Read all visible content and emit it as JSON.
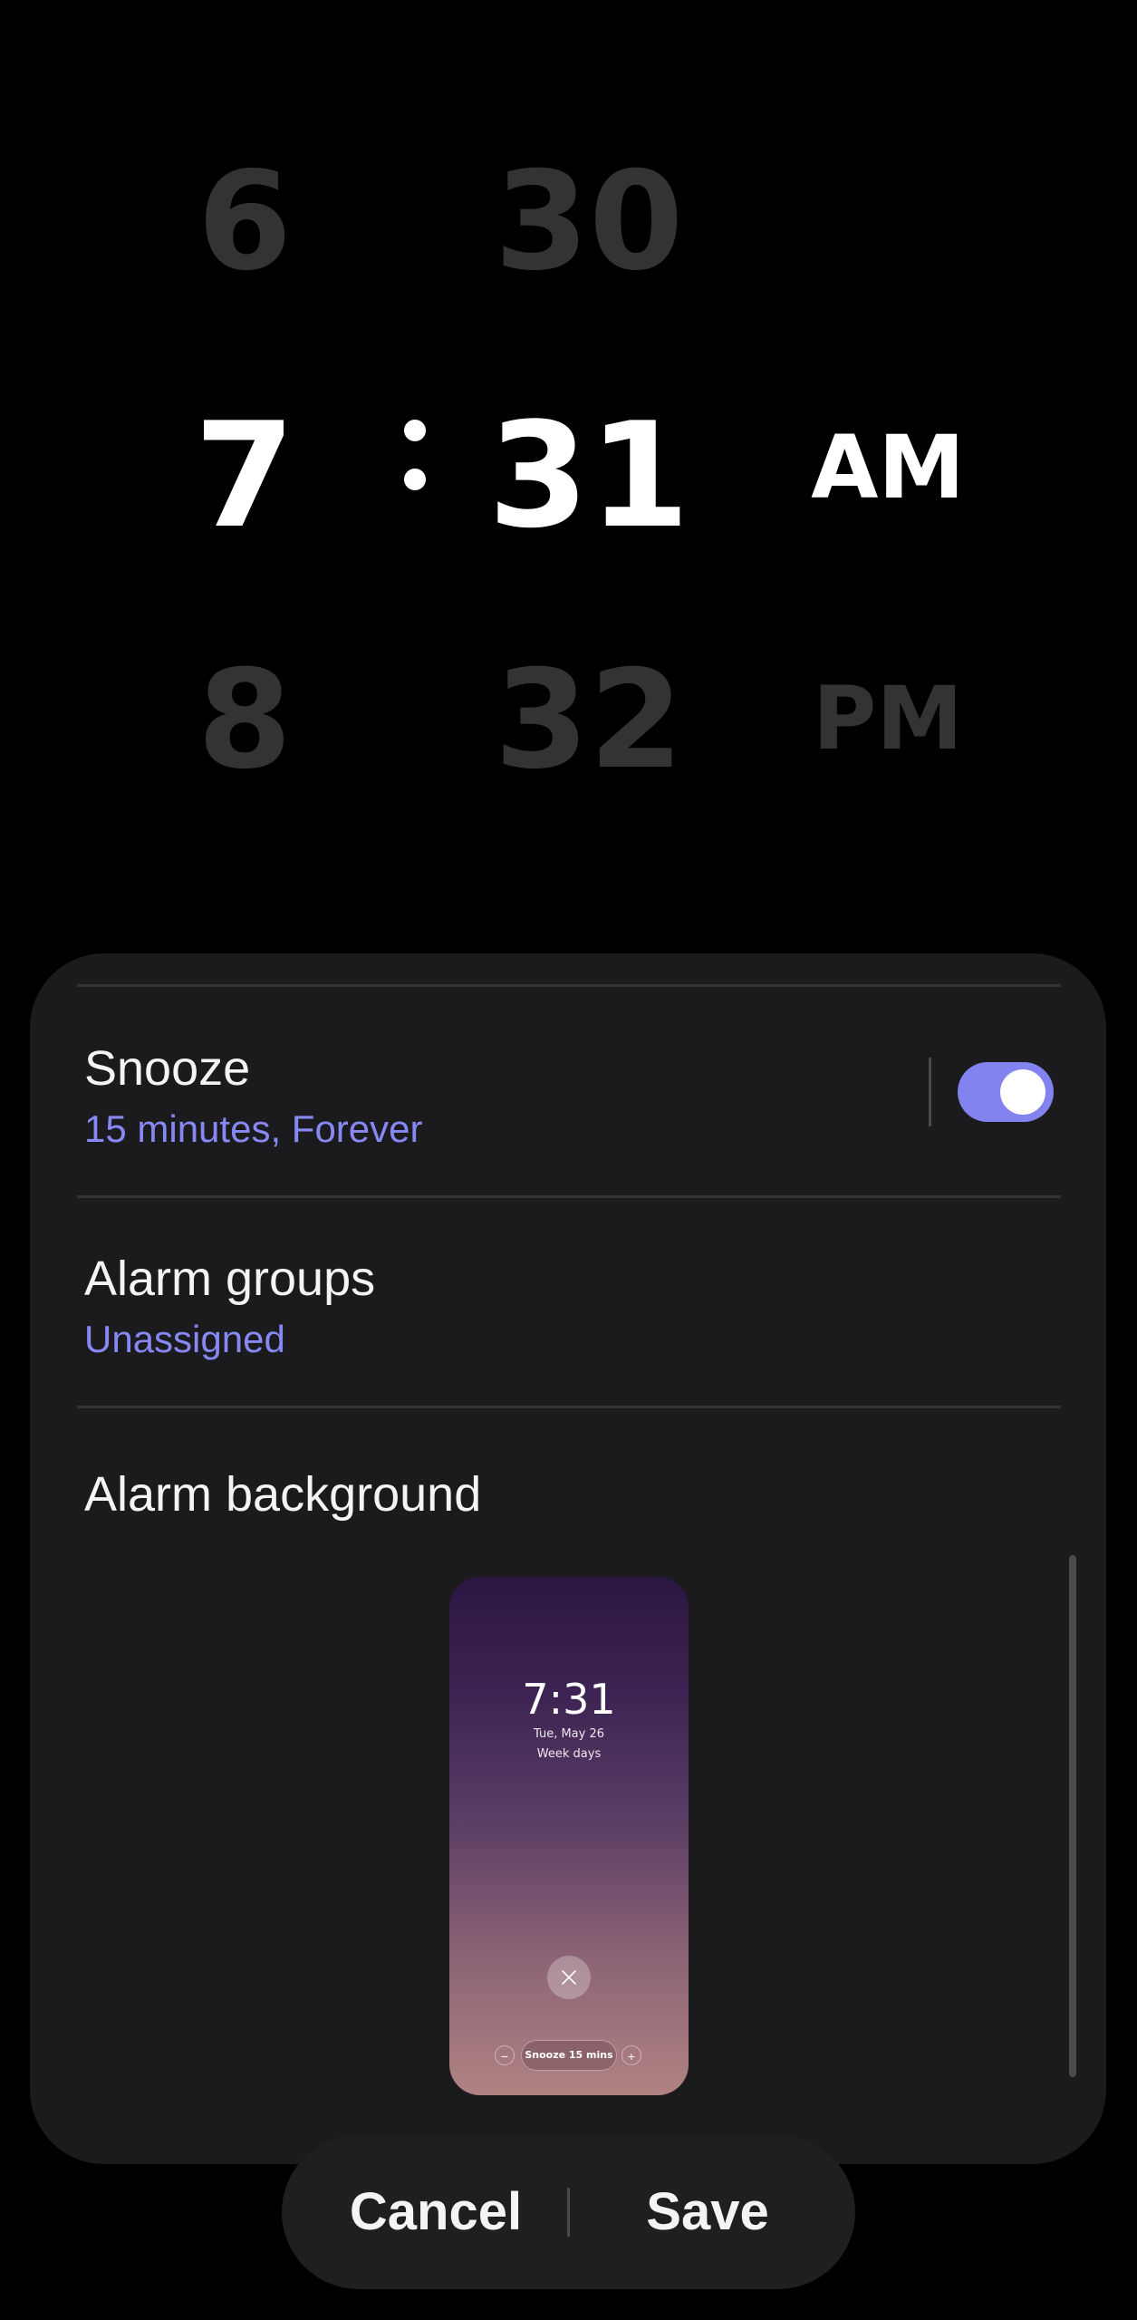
{
  "time_picker": {
    "hour": {
      "prev": "6",
      "current": "7",
      "next": "8"
    },
    "minute": {
      "prev": "30",
      "current": "31",
      "next": "32"
    },
    "period": {
      "current": "AM",
      "next": "PM"
    }
  },
  "settings": {
    "snooze": {
      "title": "Snooze",
      "subtitle": "15 minutes, Forever",
      "enabled": true
    },
    "alarm_groups": {
      "title": "Alarm groups",
      "subtitle": "Unassigned"
    },
    "alarm_background": {
      "title": "Alarm background",
      "preview": {
        "time": "7:31",
        "date": "Tue, May 26",
        "repeat": "Week days",
        "snooze_label": "Snooze 15 mins"
      }
    }
  },
  "actions": {
    "cancel": "Cancel",
    "save": "Save"
  },
  "colors": {
    "accent": "#8383f0",
    "subtitle": "#8888f4",
    "sheet_bg": "#1b1b1d",
    "faded_digit": "#333333"
  }
}
